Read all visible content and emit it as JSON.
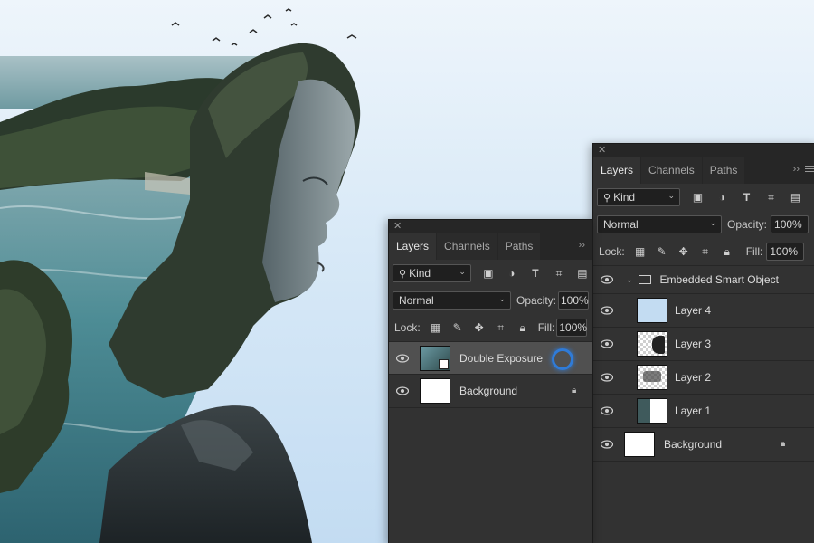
{
  "panel_front": {
    "tabs": [
      "Layers",
      "Channels",
      "Paths"
    ],
    "active_tab": "Layers",
    "kind_label": "Kind",
    "blend_mode": "Normal",
    "opacity_label": "Opacity:",
    "opacity_value": "100%",
    "lock_label": "Lock:",
    "fill_label": "Fill:",
    "fill_value": "100%",
    "layers": [
      {
        "name": "Double Exposure",
        "selected": true,
        "smart_object": true
      },
      {
        "name": "Background",
        "locked": true
      }
    ]
  },
  "panel_back": {
    "tabs": [
      "Layers",
      "Channels",
      "Paths"
    ],
    "active_tab": "Layers",
    "kind_label": "Kind",
    "blend_mode": "Normal",
    "opacity_label": "Opacity:",
    "opacity_value": "100%",
    "lock_label": "Lock:",
    "fill_label": "Fill:",
    "fill_value": "100%",
    "group_name": "Embedded Smart Object",
    "layers": [
      {
        "name": "Layer 4"
      },
      {
        "name": "Layer 3"
      },
      {
        "name": "Layer 2"
      },
      {
        "name": "Layer 1"
      },
      {
        "name": "Background",
        "locked": true
      }
    ]
  },
  "icons": {
    "close": "close-icon",
    "search": "search-icon",
    "eye": "eye-icon",
    "lock": "lock-icon",
    "folder": "folder-icon"
  },
  "colors": {
    "panel_bg": "#323232",
    "selected_row": "#505050",
    "sky": "#d8e9f7",
    "cursor_ring": "#2f7bd8"
  }
}
